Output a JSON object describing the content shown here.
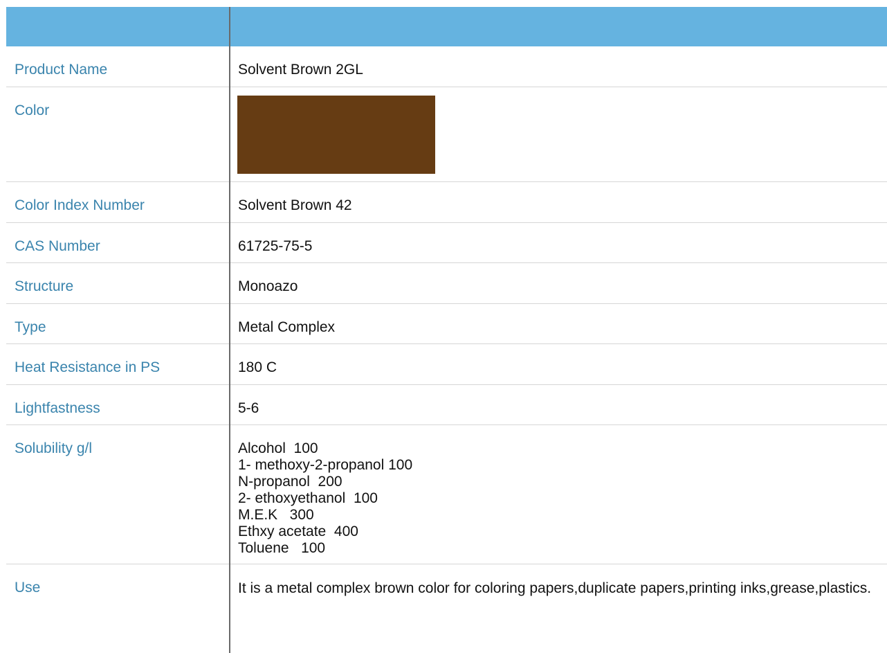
{
  "header": {
    "left": "",
    "right": ""
  },
  "rows": {
    "product_name": {
      "label": "Product Name",
      "value": "Solvent Brown 2GL"
    },
    "color": {
      "label": "Color",
      "swatch_color": "#663c13"
    },
    "color_index": {
      "label": "Color Index Number",
      "value": "Solvent Brown 42"
    },
    "cas": {
      "label": "CAS Number",
      "value": "61725-75-5"
    },
    "structure": {
      "label": "Structure",
      "value": "Monoazo"
    },
    "type": {
      "label": "Type",
      "value": "Metal Complex"
    },
    "heat": {
      "label": "Heat Resistance in PS",
      "value": "180 C"
    },
    "lightfastness": {
      "label": "Lightfastness",
      "value": "5-6"
    },
    "solubility": {
      "label": "Solubility g/l",
      "lines": [
        "Alcohol  100",
        "1- methoxy-2-propanol 100",
        "N-propanol  200",
        "2- ethoxyethanol  100",
        "M.E.K   300",
        "Ethxy acetate  400",
        "Toluene   100"
      ]
    },
    "use": {
      "label": "Use",
      "value": "It is a metal complex brown color for coloring papers,duplicate papers,printing inks,grease,plastics."
    }
  },
  "colors": {
    "header_bg": "#65b3e0",
    "label_text": "#3a84ad",
    "value_text": "#111111",
    "row_border": "#d6d6d6",
    "column_divider": "#6a6a6a"
  }
}
